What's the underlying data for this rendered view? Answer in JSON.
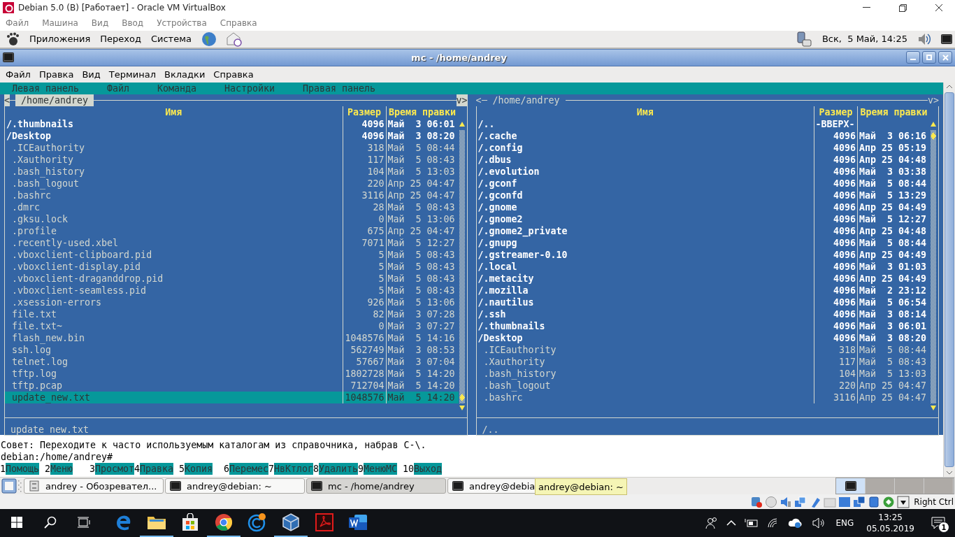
{
  "vbox_window": {
    "title": "Debian 5.0 (B) [Работает] - Oracle VM VirtualBox",
    "menu": [
      "Файл",
      "Машина",
      "Вид",
      "Ввод",
      "Устройства",
      "Справка"
    ]
  },
  "gnome_panel": {
    "menu": [
      "Приложения",
      "Переход",
      "Система"
    ],
    "clock": "Вск,  5 Май, 14:25"
  },
  "terminal_window": {
    "title": "mc - /home/andrey",
    "menu": [
      "Файл",
      "Правка",
      "Вид",
      "Терминал",
      "Вкладки",
      "Справка"
    ]
  },
  "mc": {
    "menu": [
      "Левая панель",
      "Файл",
      "Команда",
      "Настройки",
      "Правая панель"
    ],
    "panels": [
      {
        "path": "/home/andrey",
        "active": true,
        "nav_left": "<",
        "nav_right": "v>",
        "columns": [
          "Имя",
          "Размер",
          "Время правки"
        ],
        "status": "update_new.txt",
        "rows": [
          {
            "kind": "dir",
            "name": "/.thumbnails",
            "size": "4096",
            "date": "Май  3 06:01",
            "selected": false
          },
          {
            "kind": "dir",
            "name": "/Desktop",
            "size": "4096",
            "date": "Май  3 08:20",
            "selected": false
          },
          {
            "kind": "file",
            "name": ".ICEauthority",
            "size": "318",
            "date": "Май  5 08:44",
            "selected": false
          },
          {
            "kind": "file",
            "name": ".Xauthority",
            "size": "117",
            "date": "Май  5 08:43",
            "selected": false
          },
          {
            "kind": "file",
            "name": ".bash_history",
            "size": "104",
            "date": "Май  5 13:03",
            "selected": false
          },
          {
            "kind": "file",
            "name": ".bash_logout",
            "size": "220",
            "date": "Апр 25 04:47",
            "selected": false
          },
          {
            "kind": "file",
            "name": ".bashrc",
            "size": "3116",
            "date": "Апр 25 04:47",
            "selected": false
          },
          {
            "kind": "file",
            "name": ".dmrc",
            "size": "28",
            "date": "Май  5 08:43",
            "selected": false
          },
          {
            "kind": "file",
            "name": ".gksu.lock",
            "size": "0",
            "date": "Май  5 13:06",
            "selected": false
          },
          {
            "kind": "file",
            "name": ".profile",
            "size": "675",
            "date": "Апр 25 04:47",
            "selected": false
          },
          {
            "kind": "file",
            "name": ".recently-used.xbel",
            "size": "7071",
            "date": "Май  5 12:27",
            "selected": false
          },
          {
            "kind": "file",
            "name": ".vboxclient-clipboard.pid",
            "size": "5",
            "date": "Май  5 08:43",
            "selected": false
          },
          {
            "kind": "file",
            "name": ".vboxclient-display.pid",
            "size": "5",
            "date": "Май  5 08:43",
            "selected": false
          },
          {
            "kind": "file",
            "name": ".vboxclient-draganddrop.pid",
            "size": "5",
            "date": "Май  5 08:43",
            "selected": false
          },
          {
            "kind": "file",
            "name": ".vboxclient-seamless.pid",
            "size": "5",
            "date": "Май  5 08:43",
            "selected": false
          },
          {
            "kind": "file",
            "name": ".xsession-errors",
            "size": "926",
            "date": "Май  5 13:06",
            "selected": false
          },
          {
            "kind": "file",
            "name": "file.txt",
            "size": "82",
            "date": "Май  3 07:28",
            "selected": false
          },
          {
            "kind": "file",
            "name": "file.txt~",
            "size": "0",
            "date": "Май  3 07:27",
            "selected": false
          },
          {
            "kind": "file",
            "name": "flash_new.bin",
            "size": "1048576",
            "date": "Май  5 14:16",
            "selected": false
          },
          {
            "kind": "file",
            "name": "ssh.log",
            "size": "562749",
            "date": "Май  3 08:53",
            "selected": false
          },
          {
            "kind": "file",
            "name": "telnet.log",
            "size": "57667",
            "date": "Май  3 07:04",
            "selected": false
          },
          {
            "kind": "file",
            "name": "tftp.log",
            "size": "1802728",
            "date": "Май  5 14:20",
            "selected": false
          },
          {
            "kind": "file",
            "name": "tftp.pcap",
            "size": "712704",
            "date": "Май  5 14:20",
            "selected": false
          },
          {
            "kind": "file",
            "name": "update_new.txt",
            "size": "1048576",
            "date": "Май  5 14:20",
            "selected": true
          }
        ]
      },
      {
        "path": "/home/andrey",
        "active": false,
        "nav_left": "<",
        "nav_right": "v>",
        "columns": [
          "Имя",
          "Размер",
          "Время правки"
        ],
        "status": "/..",
        "rows": [
          {
            "kind": "updir",
            "name": "/..",
            "size": "-ВВЕРХ-",
            "selected": false
          },
          {
            "kind": "dir",
            "name": "/.cache",
            "size": "4096",
            "date": "Май  3 06:16",
            "selected": false
          },
          {
            "kind": "dir",
            "name": "/.config",
            "size": "4096",
            "date": "Апр 25 05:19",
            "selected": false
          },
          {
            "kind": "dir",
            "name": "/.dbus",
            "size": "4096",
            "date": "Апр 25 04:48",
            "selected": false
          },
          {
            "kind": "dir",
            "name": "/.evolution",
            "size": "4096",
            "date": "Май  3 03:38",
            "selected": false
          },
          {
            "kind": "dir",
            "name": "/.gconf",
            "size": "4096",
            "date": "Май  5 08:44",
            "selected": false
          },
          {
            "kind": "dir",
            "name": "/.gconfd",
            "size": "4096",
            "date": "Май  5 13:29",
            "selected": false
          },
          {
            "kind": "dir",
            "name": "/.gnome",
            "size": "4096",
            "date": "Апр 25 04:49",
            "selected": false
          },
          {
            "kind": "dir",
            "name": "/.gnome2",
            "size": "4096",
            "date": "Май  5 12:27",
            "selected": false
          },
          {
            "kind": "dir",
            "name": "/.gnome2_private",
            "size": "4096",
            "date": "Апр 25 04:48",
            "selected": false
          },
          {
            "kind": "dir",
            "name": "/.gnupg",
            "size": "4096",
            "date": "Май  5 08:44",
            "selected": false
          },
          {
            "kind": "dir",
            "name": "/.gstreamer-0.10",
            "size": "4096",
            "date": "Апр 25 04:49",
            "selected": false
          },
          {
            "kind": "dir",
            "name": "/.local",
            "size": "4096",
            "date": "Май  3 01:03",
            "selected": false
          },
          {
            "kind": "dir",
            "name": "/.metacity",
            "size": "4096",
            "date": "Апр 25 04:49",
            "selected": false
          },
          {
            "kind": "dir",
            "name": "/.mozilla",
            "size": "4096",
            "date": "Май  2 23:12",
            "selected": false
          },
          {
            "kind": "dir",
            "name": "/.nautilus",
            "size": "4096",
            "date": "Май  5 06:54",
            "selected": false
          },
          {
            "kind": "dir",
            "name": "/.ssh",
            "size": "4096",
            "date": "Май  3 08:14",
            "selected": false
          },
          {
            "kind": "dir",
            "name": "/.thumbnails",
            "size": "4096",
            "date": "Май  3 06:01",
            "selected": false
          },
          {
            "kind": "dir",
            "name": "/Desktop",
            "size": "4096",
            "date": "Май  3 08:20",
            "selected": false
          },
          {
            "kind": "file",
            "name": ".ICEauthority",
            "size": "318",
            "date": "Май  5 08:44",
            "selected": false
          },
          {
            "kind": "file",
            "name": ".Xauthority",
            "size": "117",
            "date": "Май  5 08:43",
            "selected": false
          },
          {
            "kind": "file",
            "name": ".bash_history",
            "size": "104",
            "date": "Май  5 13:03",
            "selected": false
          },
          {
            "kind": "file",
            "name": ".bash_logout",
            "size": "220",
            "date": "Апр 25 04:47",
            "selected": false
          },
          {
            "kind": "file",
            "name": ".bashrc",
            "size": "3116",
            "date": "Апр 25 04:47",
            "selected": false
          }
        ]
      }
    ],
    "hint": "Совет: Переходите к часто используемым каталогам из справочника, набрав C-\\.",
    "prompt": "debian:/home/andrey#",
    "function_keys": [
      {
        "number": "1",
        "label": "Помощь"
      },
      {
        "number": "2",
        "label": "Меню"
      },
      {
        "number": "3",
        "label": "Просмот"
      },
      {
        "number": "4",
        "label": "Правка"
      },
      {
        "number": "5",
        "label": "Копия"
      },
      {
        "number": "6",
        "label": "Перемес"
      },
      {
        "number": "7",
        "label": "НвКтлог"
      },
      {
        "number": "8",
        "label": "Удалить"
      },
      {
        "number": "9",
        "label": "МенюМС"
      },
      {
        "number": "10",
        "label": "Выход"
      }
    ]
  },
  "gnome_taskbar": {
    "tasks": [
      {
        "kind": "file-manager",
        "label": "andrey - Обозревател...",
        "selected": false
      },
      {
        "kind": "terminal",
        "label": "andrey@debian: ~",
        "selected": false
      },
      {
        "kind": "terminal",
        "label": "mc - /home/andrey",
        "selected": true
      },
      {
        "kind": "terminal",
        "label": "andrey@debia",
        "selected": false
      }
    ],
    "tooltip": "andrey@debian: ~",
    "workspaces": [
      {
        "selected": true
      },
      {
        "selected": false
      },
      {
        "selected": false
      },
      {
        "selected": false
      }
    ]
  },
  "vbox_status": {
    "host_key": "Right Ctrl"
  },
  "windows_taskbar": {
    "apps": [
      {
        "kind": "edge",
        "running": false
      },
      {
        "kind": "explorer",
        "running": true
      },
      {
        "kind": "store",
        "running": false
      },
      {
        "kind": "chrome",
        "running": true
      },
      {
        "kind": "ccleaner",
        "running": false
      },
      {
        "kind": "virtualbox",
        "running": true
      },
      {
        "kind": "pdf",
        "running": false
      },
      {
        "kind": "word",
        "running": false
      }
    ],
    "language": "ENG",
    "time": "13:25",
    "date": "05.05.2019",
    "notifications": "1"
  }
}
